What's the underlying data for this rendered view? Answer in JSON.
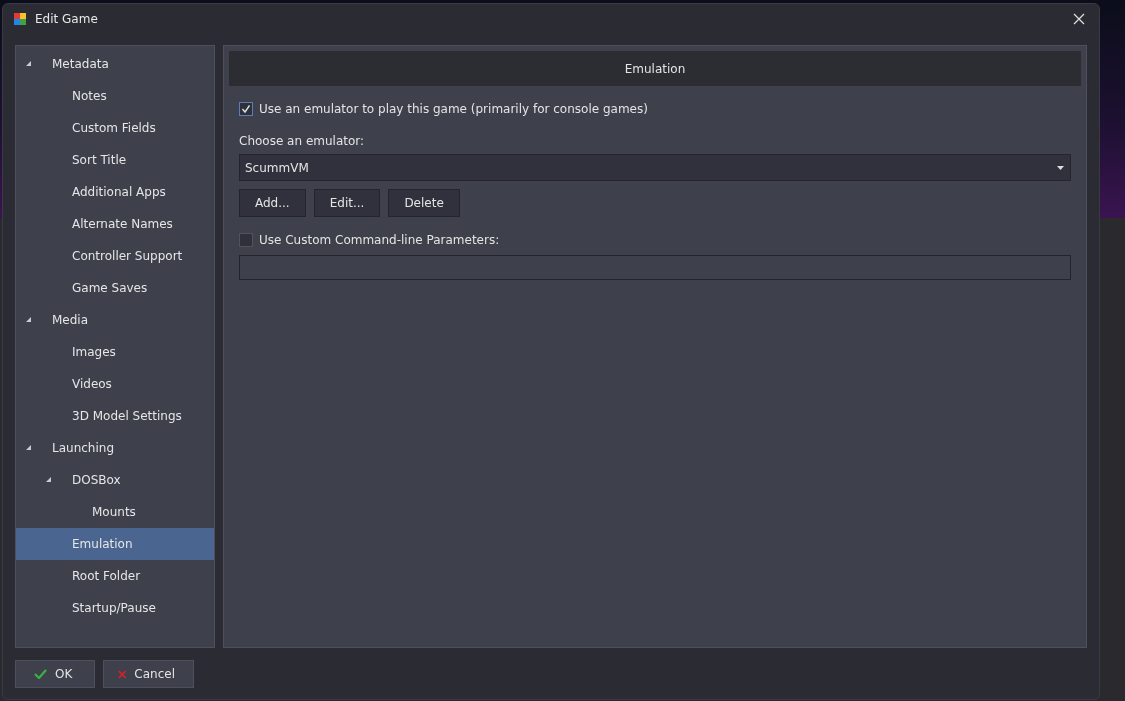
{
  "window": {
    "title": "Edit Game"
  },
  "sidebar": {
    "items": [
      {
        "label": "Metadata",
        "expanded": true,
        "selected": false,
        "children": [
          {
            "label": "Notes",
            "selected": false
          },
          {
            "label": "Custom Fields",
            "selected": false
          },
          {
            "label": "Sort Title",
            "selected": false
          },
          {
            "label": "Additional Apps",
            "selected": false
          },
          {
            "label": "Alternate Names",
            "selected": false
          },
          {
            "label": "Controller Support",
            "selected": false
          },
          {
            "label": "Game Saves",
            "selected": false
          }
        ]
      },
      {
        "label": "Media",
        "expanded": true,
        "selected": false,
        "children": [
          {
            "label": "Images",
            "selected": false
          },
          {
            "label": "Videos",
            "selected": false
          },
          {
            "label": "3D Model Settings",
            "selected": false
          }
        ]
      },
      {
        "label": "Launching",
        "expanded": true,
        "selected": false,
        "children": [
          {
            "label": "DOSBox",
            "expanded": true,
            "selected": false,
            "children": [
              {
                "label": "Mounts",
                "selected": false
              }
            ]
          },
          {
            "label": "Emulation",
            "selected": true
          },
          {
            "label": "Root Folder",
            "selected": false
          },
          {
            "label": "Startup/Pause",
            "selected": false
          }
        ]
      }
    ]
  },
  "panel": {
    "title": "Emulation",
    "use_emulator": {
      "label": "Use an emulator to play this game (primarily for console games)",
      "checked": true
    },
    "emulator_label": "Choose an emulator:",
    "emulator": {
      "value": "ScummVM"
    },
    "emulator_buttons": [
      "Add...",
      "Edit...",
      "Delete"
    ],
    "custom_params": {
      "label": "Use Custom Command-line Parameters:",
      "checked": false
    }
  },
  "buttons": [
    {
      "label": "OK",
      "kind": "ok"
    },
    {
      "label": "Cancel",
      "kind": "cancel"
    }
  ]
}
